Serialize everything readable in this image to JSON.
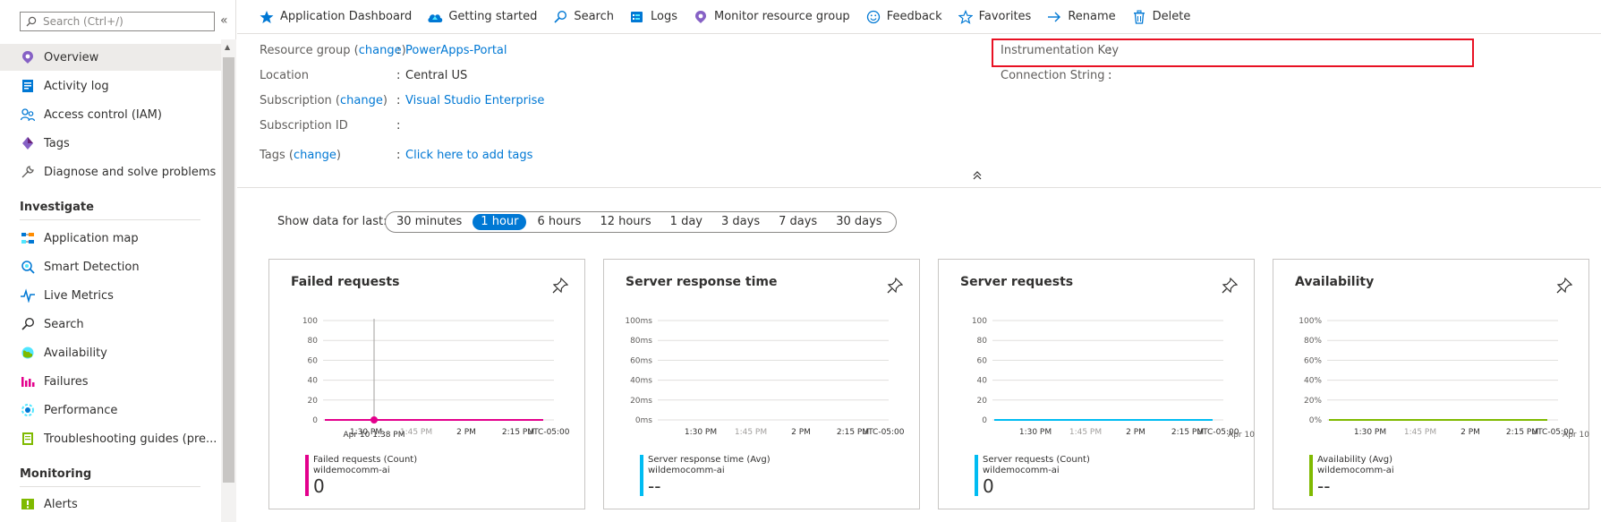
{
  "sidebar": {
    "search_placeholder": "Search (Ctrl+/)",
    "collapse_glyph": "«",
    "items": [
      {
        "label": "Overview",
        "icon": "overview-icon"
      },
      {
        "label": "Activity log",
        "icon": "activity-log-icon"
      },
      {
        "label": "Access control (IAM)",
        "icon": "access-control-icon"
      },
      {
        "label": "Tags",
        "icon": "tags-icon"
      },
      {
        "label": "Diagnose and solve problems",
        "icon": "wrench-icon"
      }
    ],
    "sections": [
      {
        "title": "Investigate",
        "items": [
          {
            "label": "Application map",
            "icon": "application-map-icon"
          },
          {
            "label": "Smart Detection",
            "icon": "smart-detection-icon"
          },
          {
            "label": "Live Metrics",
            "icon": "live-metrics-icon"
          },
          {
            "label": "Search",
            "icon": "search-icon"
          },
          {
            "label": "Availability",
            "icon": "availability-icon"
          },
          {
            "label": "Failures",
            "icon": "failures-icon"
          },
          {
            "label": "Performance",
            "icon": "performance-icon"
          },
          {
            "label": "Troubleshooting guides (pre...",
            "icon": "troubleshooting-icon"
          }
        ]
      },
      {
        "title": "Monitoring",
        "items": [
          {
            "label": "Alerts",
            "icon": "alerts-icon"
          }
        ]
      }
    ]
  },
  "toolbar": {
    "buttons": [
      {
        "label": "Application Dashboard",
        "icon": "star-icon"
      },
      {
        "label": "Getting started",
        "icon": "cloud-icon"
      },
      {
        "label": "Search",
        "icon": "search-icon"
      },
      {
        "label": "Logs",
        "icon": "logs-icon"
      },
      {
        "label": "Monitor resource group",
        "icon": "monitor-icon"
      },
      {
        "label": "Feedback",
        "icon": "smiley-icon"
      },
      {
        "label": "Favorites",
        "icon": "star-outline-icon"
      },
      {
        "label": "Rename",
        "icon": "arrow-right-icon"
      },
      {
        "label": "Delete",
        "icon": "trash-icon"
      }
    ]
  },
  "essentials": {
    "resource_group": {
      "label": "Resource group",
      "change": "change",
      "value": "PowerApps-Portal"
    },
    "location": {
      "label": "Location",
      "value": "Central US"
    },
    "subscription": {
      "label": "Subscription",
      "change": "change",
      "value": "Visual Studio Enterprise"
    },
    "subscription_id": {
      "label": "Subscription ID",
      "value": ""
    },
    "tags": {
      "label": "Tags",
      "change": "change",
      "value": "Click here to add tags"
    },
    "instrumentation_key": {
      "label": "Instrumentation Key",
      "value": ""
    },
    "connection_string": {
      "label": "Connection String",
      "value": ""
    },
    "colon": ":",
    "open_paren": "(",
    "close_paren": ")",
    "collapse_glyph": "⌃"
  },
  "time_range": {
    "label": "Show data for last:",
    "options": [
      "30 minutes",
      "1 hour",
      "6 hours",
      "12 hours",
      "1 day",
      "3 days",
      "7 days",
      "30 days"
    ],
    "selected": "1 hour"
  },
  "colors": {
    "accent": "#0078d4",
    "failed": "#e3008c",
    "response": "#00bcf2",
    "requests": "#00bcf2",
    "availability": "#7fba00",
    "highlight_box": "#e81123"
  },
  "chart_data": [
    {
      "type": "line",
      "title": "Failed requests",
      "y_ticks": [
        "100",
        "80",
        "60",
        "40",
        "20",
        "0"
      ],
      "x_ticks": [
        "1:30 PM",
        "1:45 PM",
        "2 PM",
        "2:15 PM",
        "UTC-05:00"
      ],
      "tooltip": "Apr 10 1:38 PM",
      "series": [
        {
          "name": "Failed requests (Count)",
          "resource": "wildemocomm-ai",
          "value": "0",
          "points": [
            0,
            0,
            0,
            0,
            0,
            0,
            0,
            0
          ]
        }
      ],
      "ylim": [
        0,
        100
      ]
    },
    {
      "type": "line",
      "title": "Server response time",
      "y_ticks": [
        "100ms",
        "80ms",
        "60ms",
        "40ms",
        "20ms",
        "0ms"
      ],
      "x_ticks": [
        "1:30 PM",
        "1:45 PM",
        "2 PM",
        "2:15 PM",
        "UTC-05:00"
      ],
      "series": [
        {
          "name": "Server response time (Avg)",
          "resource": "wildemocomm-ai",
          "value": "--",
          "points": []
        }
      ],
      "ylim": [
        0,
        100
      ]
    },
    {
      "type": "line",
      "title": "Server requests",
      "y_ticks": [
        "100",
        "80",
        "60",
        "40",
        "20",
        "0"
      ],
      "x_ticks": [
        "1:30 PM",
        "1:45 PM",
        "2 PM",
        "2:15 PM",
        "UTC-05:00"
      ],
      "x_extra": "Apr 10",
      "series": [
        {
          "name": "Server requests (Count)",
          "resource": "wildemocomm-ai",
          "value": "0",
          "points": [
            0,
            0,
            0,
            0,
            0,
            0,
            0,
            0
          ]
        }
      ],
      "ylim": [
        0,
        100
      ]
    },
    {
      "type": "line",
      "title": "Availability",
      "y_ticks": [
        "100%",
        "80%",
        "60%",
        "40%",
        "20%",
        "0%"
      ],
      "x_ticks": [
        "1:30 PM",
        "1:45 PM",
        "2 PM",
        "2:15 PM",
        "UTC-05:00"
      ],
      "x_extra": "Apr 10",
      "series": [
        {
          "name": "Availability (Avg)",
          "resource": "wildemocomm-ai",
          "value": "--",
          "points": [
            0,
            0,
            0,
            0,
            0,
            0,
            0,
            0
          ]
        }
      ],
      "ylim": [
        0,
        100
      ]
    }
  ]
}
